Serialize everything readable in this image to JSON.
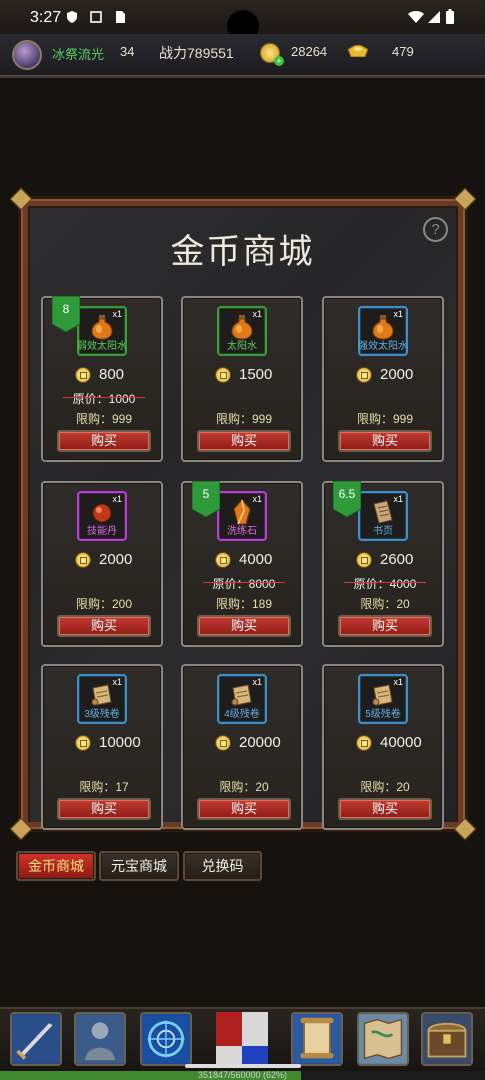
{
  "status": {
    "time": "3:27"
  },
  "player": {
    "name": "冰祭流光",
    "level": "34",
    "power": "战力789551",
    "gold": "28264",
    "ingot": "479"
  },
  "shop": {
    "title": "金币商城",
    "help": "?",
    "buy_label": "购买",
    "orig_prefix": "原价：",
    "limit_prefix": "限购：",
    "items": [
      {
        "name": "弱效太阳水",
        "qty": "x1",
        "rarity": "green",
        "icon": "potion-icon",
        "price": "800",
        "orig": "原价：1000",
        "limit": "限购：999",
        "badge": "8"
      },
      {
        "name": "太阳水",
        "qty": "x1",
        "rarity": "green",
        "icon": "potion-icon",
        "price": "1500",
        "orig": "",
        "limit": "限购：999",
        "badge": ""
      },
      {
        "name": "强效太阳水",
        "qty": "x1",
        "rarity": "blue",
        "icon": "potion-icon",
        "price": "2000",
        "orig": "",
        "limit": "限购：999",
        "badge": ""
      },
      {
        "name": "技能丹",
        "qty": "x1",
        "rarity": "purple",
        "icon": "pill-icon",
        "price": "2000",
        "orig": "",
        "limit": "限购：200",
        "badge": ""
      },
      {
        "name": "洗练石",
        "qty": "x1",
        "rarity": "purple",
        "icon": "stone-icon",
        "price": "4000",
        "orig": "原价：8000",
        "limit": "限购：189",
        "badge": "5"
      },
      {
        "name": "书页",
        "qty": "x1",
        "rarity": "blue",
        "icon": "page-icon",
        "price": "2600",
        "orig": "原价：4000",
        "limit": "限购：20",
        "badge": "6.5"
      },
      {
        "name": "3级残卷",
        "qty": "x1",
        "rarity": "blue",
        "icon": "scroll-icon",
        "price": "10000",
        "orig": "",
        "limit": "限购：17",
        "badge": ""
      },
      {
        "name": "4级残卷",
        "qty": "x1",
        "rarity": "blue",
        "icon": "scroll-icon",
        "price": "20000",
        "orig": "",
        "limit": "限购：20",
        "badge": ""
      },
      {
        "name": "5级残卷",
        "qty": "x1",
        "rarity": "blue",
        "icon": "scroll-icon",
        "price": "40000",
        "orig": "",
        "limit": "限购：20",
        "badge": ""
      }
    ]
  },
  "tabs": [
    {
      "label": "金币商城",
      "active": true
    },
    {
      "label": "元宝商城",
      "active": false
    },
    {
      "label": "兑换码",
      "active": false
    }
  ],
  "nav": [
    "sword-icon",
    "warrior-icon",
    "magic-circle-icon",
    "flag-icon",
    "scroll-icon",
    "map-icon",
    "chest-icon"
  ],
  "xp": {
    "text": "351847/560000 (62%)",
    "fraction": 0.62
  },
  "colors": {
    "green": "#3c9a3c",
    "blue": "#3f8fc4",
    "purple": "#b63ed0",
    "buy": "#b02b23"
  }
}
